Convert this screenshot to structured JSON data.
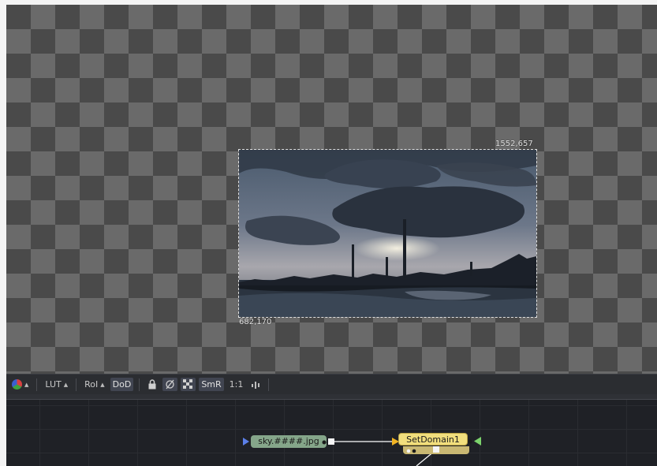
{
  "viewer": {
    "coord_top_right": "1552,657",
    "coord_bottom_left": "682,170"
  },
  "toolbar": {
    "color_icon": "color-channels-icon",
    "lut_label": "LUT",
    "roi_label": "RoI",
    "dod_label": "DoD",
    "smr_label": "SmR",
    "zoom_label": "1:1"
  },
  "flow": {
    "loader_node": "sky.####.jpg",
    "setdomain_node": "SetDomain1"
  },
  "colors": {
    "accent_green": "#85a68a",
    "accent_yellow": "#f1de7d",
    "input_port": "#5b7fe8",
    "output_port": "#7cd46c",
    "wire": "#ffffff"
  }
}
